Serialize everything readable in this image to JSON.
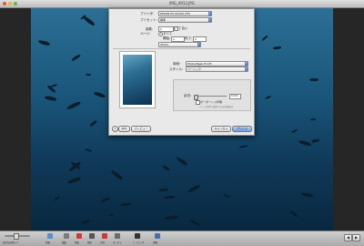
{
  "window": {
    "title": "IMG_4913.JPG"
  },
  "print_dialog": {
    "printer_label": "プリンタ:",
    "printer_value": "EPSON PX-G5100 (FP)",
    "preset_label": "プリセット:",
    "preset_value": "標準",
    "copies_label": "部数:",
    "copies_value": "1",
    "collated_label": "丁合い",
    "pages_label": "ページ:",
    "pages_all": "すべて",
    "pages_from_label": "開始:",
    "pages_from_value": "1",
    "pages_to_label": "終了:",
    "pages_to_value": "1",
    "section_value": "iPhoto",
    "size_label": "用紙:",
    "size_value": "Photo/Ngan ft inft",
    "style_label": "スタイル:",
    "style_value": "ベーシック",
    "margin_label": "余白:",
    "margin_value": "0 mm",
    "checkbox_label": "ボーダーレス印刷",
    "note": "ページ全体で使用できる印刷設定",
    "help_label": "?",
    "pdf_label": "PDF",
    "preview_label": "プレビュー",
    "cancel_label": "キャンセル",
    "print_label": "プリント"
  },
  "toolbar": {
    "zoom_value": "表示を使用して",
    "items": [
      {
        "label": "情報",
        "color": "#5a8fd4"
      },
      {
        "label": "編集",
        "color": "#7a7a7a"
      },
      {
        "label": "回転",
        "color": "#cc3b3b"
      },
      {
        "label": "補正",
        "color": "#555555"
      },
      {
        "label": "赤目",
        "color": "#c73a3a"
      },
      {
        "label": "まっすぐ",
        "color": "#6a6a6a"
      },
      {
        "label": "トリミング",
        "color": "#333333"
      },
      {
        "label": "調整",
        "color": "#4a6fa8"
      }
    ],
    "prev_label": "◀",
    "next_label": "▶"
  }
}
